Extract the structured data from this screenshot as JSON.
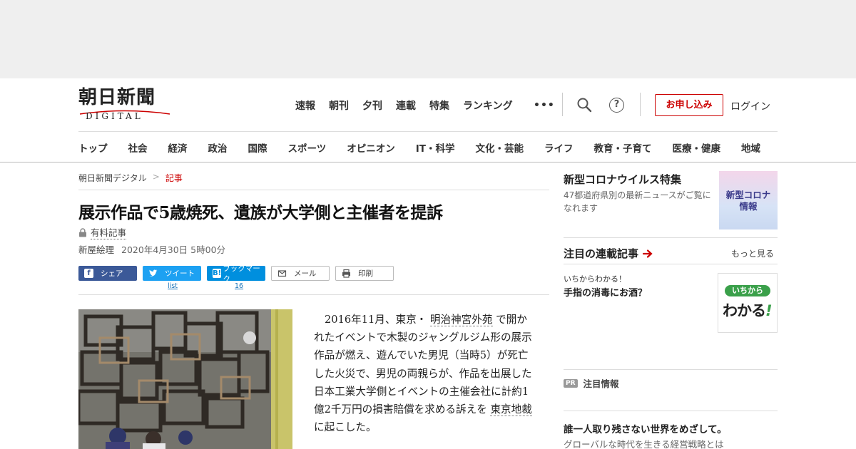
{
  "header": {
    "logo_kanji": "朝日新聞",
    "logo_sub": "DIGITAL",
    "nav": [
      "速報",
      "朝刊",
      "夕刊",
      "連載",
      "特集",
      "ランキング"
    ],
    "more": "•••",
    "apply_label": "お申し込み",
    "login_label": "ログイン",
    "help_glyph": "?"
  },
  "categories": [
    "トップ",
    "社会",
    "経済",
    "政治",
    "国際",
    "スポーツ",
    "オピニオン",
    "IT・科学",
    "文化・芸能",
    "ライフ",
    "教育・子育て",
    "医療・健康",
    "地域"
  ],
  "breadcrumb": {
    "home": "朝日新聞デジタル",
    "sep": ">",
    "current": "記事"
  },
  "article": {
    "title": "展示作品で5歳焼死、遺族が大学側と主催者を提訴",
    "paid_label": "有料記事",
    "author": "新屋絵理",
    "date": "2020年4月30日 5時00分",
    "body_parts": {
      "p1": "2016年11月、東京・",
      "link1": "明治神宮外苑",
      "p2": "で開かれたイベントで木製のジャングルジム形の展示作品が燃え、遊んでいた男児（当時5）が死亡した火災で、男児の両親らが、作品を出展した日本工業大学側とイベントの主催会社に計約1億2千万円の損害賠償を求める訴えを",
      "link2": "東京地裁",
      "p3": "に起こした。"
    }
  },
  "share": {
    "facebook": "シェア",
    "twitter": "ツイート",
    "twitter_count": "list",
    "hatena": "ブックマーク",
    "hatena_count": "16",
    "hatena_glyph": "B!",
    "mail": "メール",
    "print": "印刷"
  },
  "sidebar": {
    "corona_title": "新型コロナウイルス特集",
    "corona_desc": "47都道府県別の最新ニュースがご覧になれます",
    "corona_img_line1": "新型コロナ",
    "corona_img_line2": "情報",
    "series_title": "注目の連載記事",
    "more_label": "もっと見る",
    "series_kicker": "いちからわかる！",
    "series_headline": "手指の消毒にお酒？",
    "wakaru_pill": "いちから",
    "wakaru_big": "わかる",
    "wakaru_exc": "!",
    "pr_badge": "PR",
    "pr_label": "注目情報",
    "ad_headline": "誰一人取り残さない世界をめざして。",
    "ad_sub": "グローバルな時代を生きる経営戦略とは"
  },
  "colors": {
    "accent_red": "#cc0000",
    "facebook": "#3b5998",
    "twitter": "#1da1f2",
    "hatena": "#008fde"
  }
}
